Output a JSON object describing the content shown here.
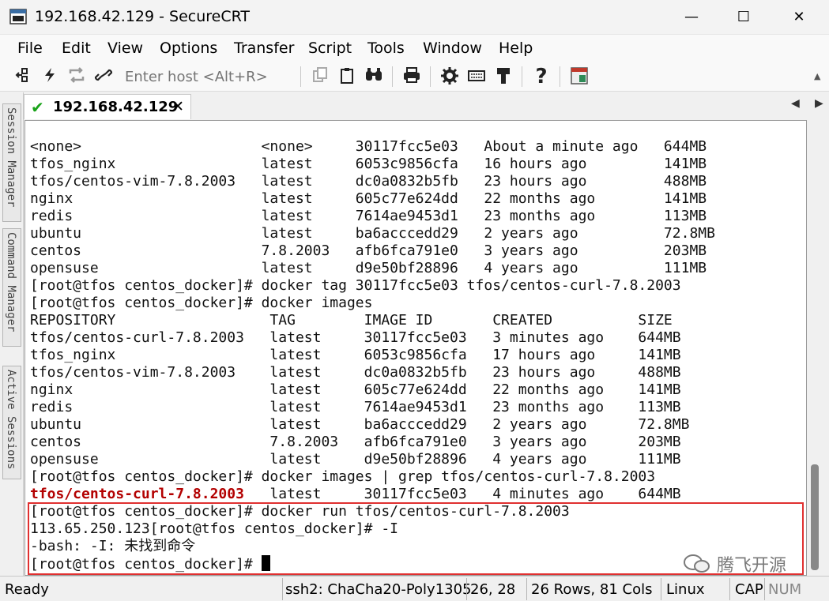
{
  "window": {
    "title": "192.168.42.129 - SecureCRT",
    "controls": [
      "—",
      "☐",
      "✕"
    ]
  },
  "menu": [
    "File",
    "Edit",
    "View",
    "Options",
    "Transfer",
    "Script",
    "Tools",
    "Window",
    "Help"
  ],
  "toolbar": {
    "host_placeholder": "Enter host <Alt+R>",
    "icons": [
      "connect-icon",
      "quick-connect-icon",
      "reconnect-icon",
      "disconnect-icon",
      "copy-icon",
      "paste-icon",
      "find-icon",
      "print-icon",
      "settings-icon",
      "keymap-icon",
      "sftp-icon",
      "help-icon",
      "screenshot-icon"
    ]
  },
  "tab": {
    "label": "192.168.42.129",
    "close": "✕",
    "check": "✔"
  },
  "side_tabs": [
    "Session Manager",
    "Command Manager",
    "Active Sessions"
  ],
  "terminal": {
    "lines": [
      "<none>                     <none>     30117fcc5e03   About a minute ago   644MB",
      "tfos_nginx                 latest     6053c9856cfa   16 hours ago         141MB",
      "tfos/centos-vim-7.8.2003   latest     dc0a0832b5fb   23 hours ago         488MB",
      "nginx                      latest     605c77e624dd   22 months ago        141MB",
      "redis                      latest     7614ae9453d1   23 months ago        113MB",
      "ubuntu                     latest     ba6acccedd29   2 years ago          72.8MB",
      "centos                     7.8.2003   afb6fca791e0   3 years ago          203MB",
      "opensuse                   latest     d9e50bf28896   4 years ago          111MB",
      "[root@tfos centos_docker]# docker tag 30117fcc5e03 tfos/centos-curl-7.8.2003",
      "[root@tfos centos_docker]# docker images",
      "REPOSITORY                  TAG        IMAGE ID       CREATED          SIZE",
      "tfos/centos-curl-7.8.2003   latest     30117fcc5e03   3 minutes ago    644MB",
      "tfos_nginx                  latest     6053c9856cfa   17 hours ago     141MB",
      "tfos/centos-vim-7.8.2003    latest     dc0a0832b5fb   23 hours ago     488MB",
      "nginx                       latest     605c77e624dd   22 months ago    141MB",
      "redis                       latest     7614ae9453d1   23 months ago    113MB",
      "ubuntu                      latest     ba6acccedd29   2 years ago      72.8MB",
      "centos                      7.8.2003   afb6fca791e0   3 years ago      203MB",
      "opensuse                    latest     d9e50bf28896   4 years ago      111MB",
      "[root@tfos centos_docker]# docker images | grep tfos/centos-curl-7.8.2003"
    ],
    "grep_match": "tfos/centos-curl-7.8.2003",
    "grep_rest": "   latest     30117fcc5e03   4 minutes ago    644MB",
    "boxed_lines": [
      "[root@tfos centos_docker]# docker run tfos/centos-curl-7.8.2003",
      "113.65.250.123[root@tfos centos_docker]# -I",
      "-bash: -I: 未找到命令"
    ],
    "prompt": "[root@tfos centos_docker]# "
  },
  "watermark": "腾飞开源",
  "status": {
    "ready": "Ready",
    "cipher": "ssh2: ChaCha20-Poly1305",
    "position": "26, 28",
    "size": "26 Rows, 81 Cols",
    "os": "Linux",
    "caps": "CAP",
    "num": "NUM"
  }
}
